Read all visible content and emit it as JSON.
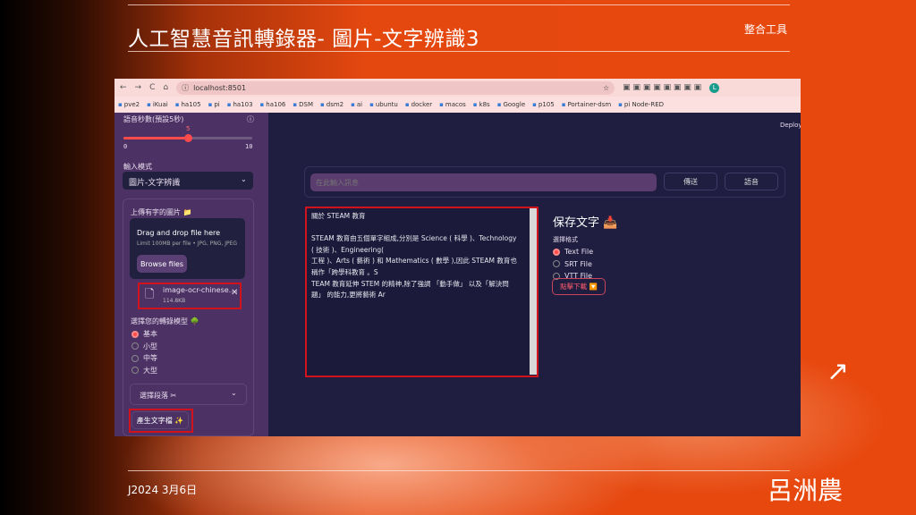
{
  "slide": {
    "title": "人工智慧音訊轉錄器- 圖片-文字辨識3",
    "tag": "整合工具",
    "date": "J2024 3月6日",
    "author": "呂洲農"
  },
  "browser": {
    "url": "localhost:8501",
    "bookmarks": [
      "pve2",
      "iKuai",
      "ha105",
      "pi",
      "ha103",
      "ha106",
      "DSM",
      "dsm2",
      "ai",
      "ubuntu",
      "docker",
      "macos",
      "k8s",
      "Google",
      "p105",
      "Portainer-dsm",
      "pi Node-RED"
    ]
  },
  "sidebar": {
    "slider_label": "語音秒數(預設5秒)",
    "slider_value": "5",
    "slider_min": "0",
    "slider_max": "10",
    "slider_fraction": 0.5,
    "input_mode_label": "輸入模式",
    "input_mode_value": "圖片-文字辨識",
    "upload_label": "上傳有字的圖片 📁",
    "drop_text": "Drag and drop file here",
    "drop_limit": "Limit 100MB per file • JPG, PNG, JPEG",
    "browse": "Browse files",
    "file_name": "image-ocr-chinese....",
    "file_size": "114.8KB",
    "model_label": "選擇您的轉錄模型 🌳",
    "models": [
      "基本",
      "小型",
      "中等",
      "大型"
    ],
    "model_selected": 0,
    "segment_label": "選擇段落 ✂",
    "generate": "產生文字檔 ✨"
  },
  "main": {
    "deploy": "Deploy",
    "input_placeholder": "在此輸入訊息",
    "send": "傳送",
    "voice": "語音",
    "text_lines": [
      "關於 STEAM 教育",
      "",
      "STEAM 教育由五個單字組成,分別是 Science ( 科學 )、Technology",
      "( 技術 )、Engineering(",
      "工程 )、Arts ( 藝術 ) 和 Mathematics ( 數學 ),因此 STEAM 教育也",
      "稱作「跨學科教育 。S",
      "TEAM 教育延伸 STEM 的精神,除了強調 「動手做」 以及「解決問",
      "題」 的能力,更將藝術 Ar"
    ],
    "save_title": "保存文字 📥",
    "format_label": "選擇格式",
    "formats": [
      "Text File",
      "SRT File",
      "VTT File"
    ],
    "format_selected": 0,
    "download": "點擊下載 🔽"
  }
}
